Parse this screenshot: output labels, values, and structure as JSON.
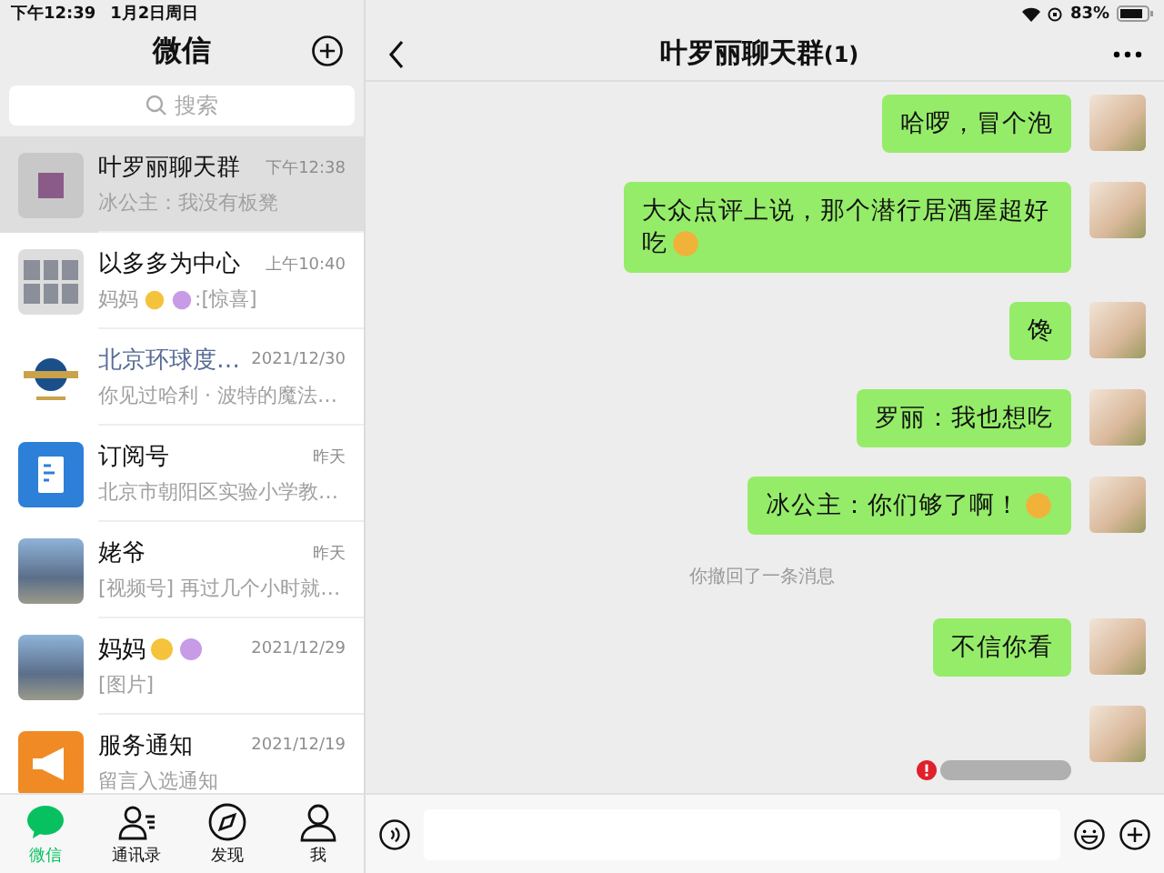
{
  "status_bar": {
    "time": "下午12:39",
    "date": "1月2日周日",
    "battery": "83%"
  },
  "sidebar": {
    "title": "微信",
    "search": {
      "placeholder": "搜索"
    },
    "chats": [
      {
        "kind": "group",
        "name": "叶罗丽聊天群",
        "time": "下午12:38",
        "preview": "冰公主：我没有板凳",
        "official": false,
        "name_emoji": false,
        "preview_emoji": false,
        "selected": true
      },
      {
        "kind": "grid",
        "name": "以多多为中心",
        "time": "上午10:40",
        "preview": "妈妈",
        "preview_tail": ":[惊喜]",
        "official": false,
        "name_emoji": false,
        "preview_emoji": true,
        "selected": false
      },
      {
        "kind": "globe",
        "name": "北京环球度…",
        "time": "2021/12/30",
        "preview": "你见过哈利 · 波特的魔法…",
        "official": true,
        "name_emoji": false,
        "preview_emoji": false,
        "selected": false
      },
      {
        "kind": "doc",
        "name": "订阅号",
        "time": "昨天",
        "preview": "北京市朝阳区实验小学教…",
        "official": false,
        "name_emoji": false,
        "preview_emoji": false,
        "selected": false
      },
      {
        "kind": "photo",
        "name": "姥爷",
        "time": "昨天",
        "preview": "[视频号] 再过几个小时就…",
        "official": false,
        "name_emoji": false,
        "preview_emoji": false,
        "selected": false
      },
      {
        "kind": "photo",
        "name": "妈妈",
        "time": "2021/12/29",
        "preview": "[图片]",
        "official": false,
        "name_emoji": true,
        "preview_emoji": false,
        "selected": false
      },
      {
        "kind": "megaphone",
        "name": "服务通知",
        "time": "2021/12/19",
        "preview": "留言入选通知",
        "official": false,
        "name_emoji": false,
        "preview_emoji": false,
        "selected": false
      }
    ],
    "tabs": [
      {
        "label": "微信",
        "selected": true
      },
      {
        "label": "通讯录",
        "selected": false
      },
      {
        "label": "发现",
        "selected": false
      },
      {
        "label": "我",
        "selected": false
      }
    ]
  },
  "chat": {
    "title": "叶罗丽聊天群",
    "count": "(1)",
    "messages": [
      {
        "kind": "text",
        "text": "哈啰，冒个泡",
        "emoji": false
      },
      {
        "kind": "text",
        "text": "大众点评上说，那个潜行居酒屋超好吃",
        "emoji": true
      },
      {
        "kind": "text",
        "text": "馋",
        "emoji": false
      },
      {
        "kind": "text",
        "text": "罗丽：我也想吃",
        "emoji": false
      },
      {
        "kind": "text",
        "text": "冰公主：你们够了啊！",
        "emoji": true
      },
      {
        "kind": "notice",
        "text": "你撤回了一条消息"
      },
      {
        "kind": "text",
        "text": "不信你看",
        "emoji": false
      },
      {
        "kind": "sticker",
        "failed": true
      }
    ]
  }
}
